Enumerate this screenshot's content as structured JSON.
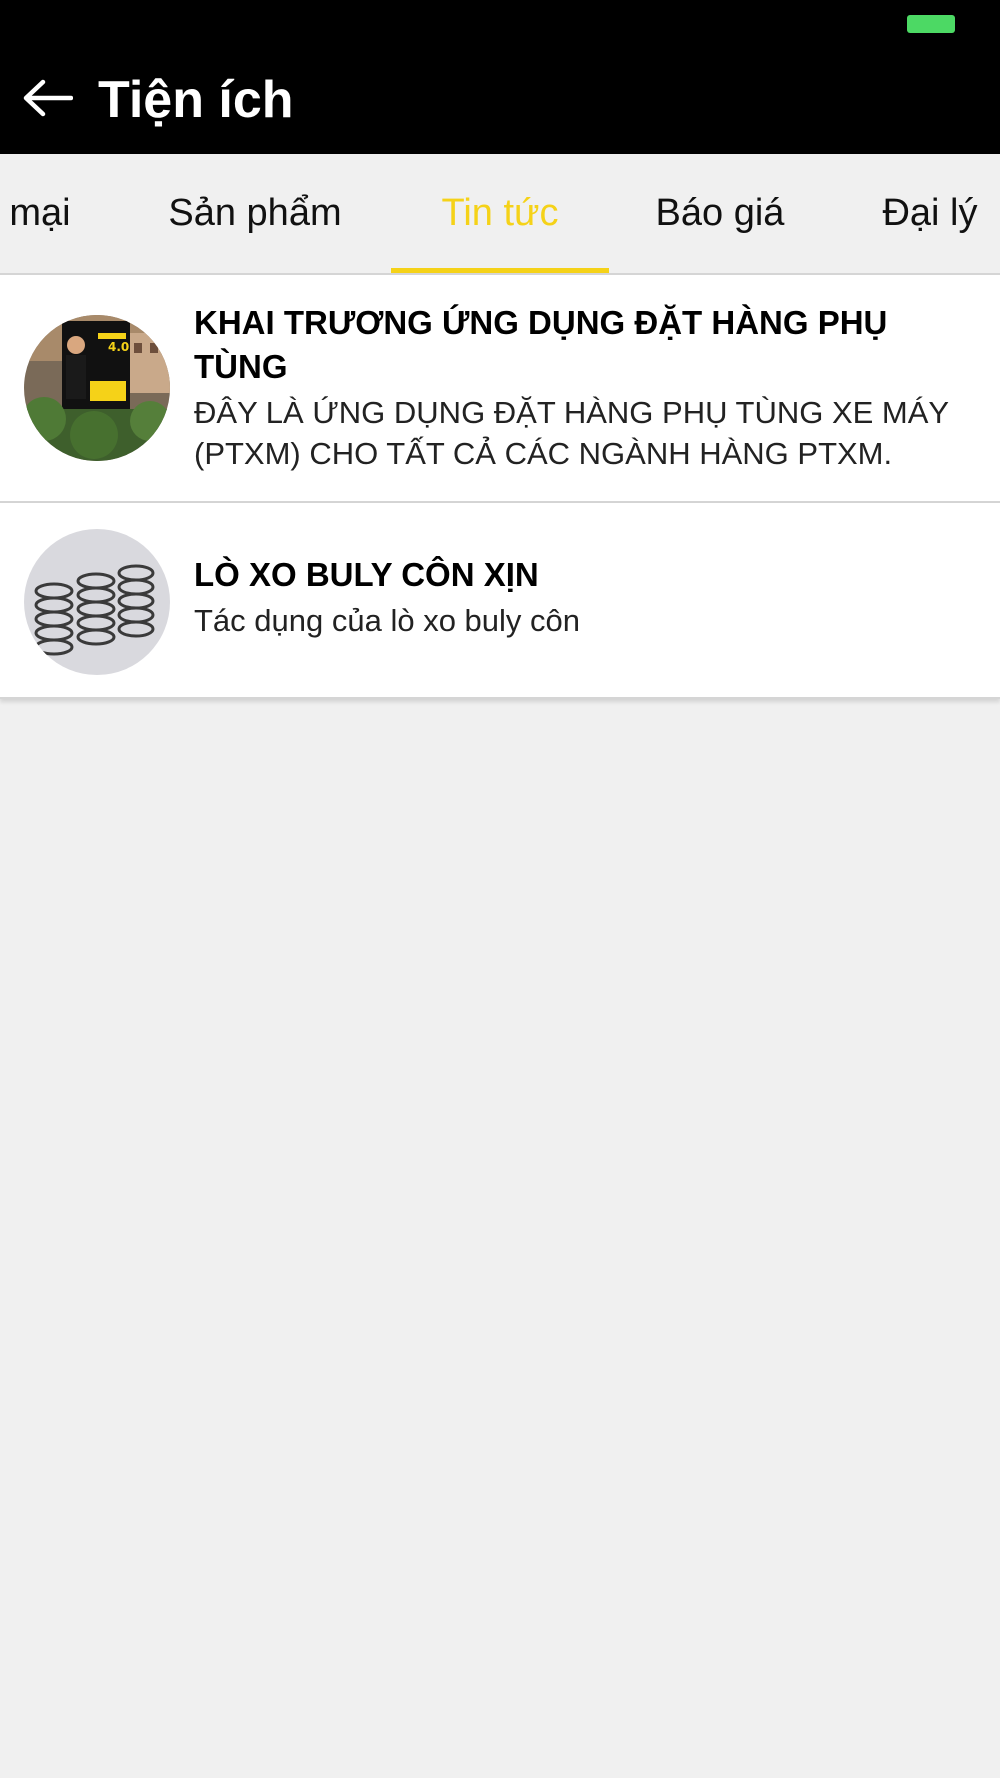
{
  "app_bar": {
    "title": "Tiện ích",
    "back_icon": "arrow-left-icon"
  },
  "status_bar": {
    "battery_color": "#4cd964"
  },
  "tabs": [
    {
      "label": "mại",
      "active": false
    },
    {
      "label": "Sản phẩm",
      "active": false
    },
    {
      "label": "Tin tức",
      "active": true
    },
    {
      "label": "Báo giá",
      "active": false
    },
    {
      "label": "Đại lý",
      "active": false
    }
  ],
  "colors": {
    "accent": "#f5d218",
    "app_bar_bg": "#000000",
    "page_bg": "#f0f0f0"
  },
  "news": [
    {
      "title": "KHAI TRƯƠNG ỨNG DỤNG ĐẶT HÀNG PHỤ TÙNG",
      "description": "ĐÂY LÀ ỨNG DỤNG ĐẶT HÀNG PHỤ TÙNG XE MÁY (PTXM) CHO TẤT CẢ CÁC NGÀNH HÀNG PTXM."
    },
    {
      "title": "LÒ XO BULY CÔN XỊN",
      "description": "Tác dụng của lò xo buly côn"
    }
  ]
}
